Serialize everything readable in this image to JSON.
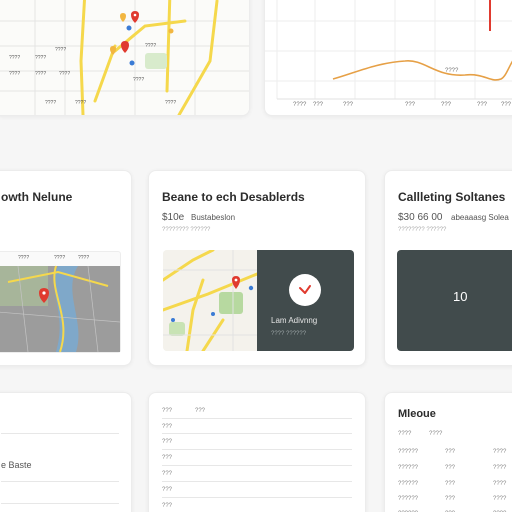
{
  "colors": {
    "page_bg": "#f6f6f6",
    "card_bg": "#ffffff",
    "dark_panel": "#414b4c",
    "road_yellow": "#f5d84c",
    "map_pin_red": "#e03a2f",
    "chart_line": "#e6a046",
    "water_blue": "#7fa8c9",
    "park_green": "#b7d9a0"
  },
  "top_map": {
    "labels": [
      "????",
      "????",
      "????",
      "????",
      "????",
      "????",
      "????",
      "????"
    ],
    "bottom_labels": [
      "????",
      "????",
      "????"
    ]
  },
  "top_chart": {
    "x_ticks": [
      "????",
      "???",
      "???",
      "???",
      "???",
      "???",
      "???"
    ],
    "annotation": "????"
  },
  "card_a": {
    "title": "owth Nelune",
    "map_labels": [
      "????",
      "????",
      "????"
    ]
  },
  "card_b": {
    "title": "Beane to ech Desablerds",
    "value": "$10e",
    "subtitle": "Bustabeslon",
    "meta": "???????? ??????",
    "panel_text": "Lam Adivnng",
    "panel_meta": "???? ??????"
  },
  "card_c": {
    "title": "Callleting Soltanes",
    "value": "$30 66 00",
    "subtitle": "abeaaasg Solea",
    "meta": "???????? ??????",
    "panel_value": "10"
  },
  "card_d": {
    "label": "e Baste"
  },
  "card_e": {
    "rows": [
      "???",
      "???",
      "???",
      "???",
      "???",
      "???",
      "???"
    ],
    "top_right": "???"
  },
  "card_f": {
    "title": "Mleoue",
    "rows": [
      [
        "????",
        "????",
        ""
      ],
      [
        "??????",
        "???",
        "????"
      ],
      [
        "??????",
        "???",
        "????"
      ],
      [
        "??????",
        "???",
        "????"
      ],
      [
        "??????",
        "???",
        "????"
      ],
      [
        "??????",
        "???",
        "????"
      ]
    ]
  }
}
